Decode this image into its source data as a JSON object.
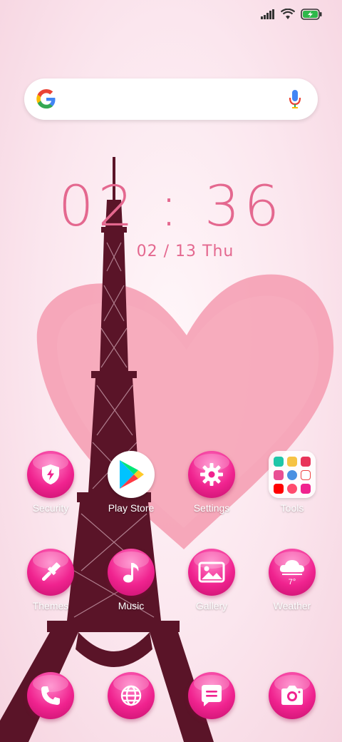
{
  "status_bar": {
    "icons": [
      "signal-icon",
      "wifi-icon",
      "battery-charging-icon"
    ]
  },
  "search": {
    "placeholder": ""
  },
  "clock": {
    "time": "02 : 36",
    "date": "02 / 13  Thu"
  },
  "apps": {
    "security": "Security",
    "play_store": "Play Store",
    "settings": "Settings",
    "tools": "Tools",
    "themes": "Themes",
    "music": "Music",
    "gallery": "Gallery",
    "weather": "Weather",
    "weather_temp": "7°"
  },
  "dock": [
    "phone-icon",
    "browser-icon",
    "messages-icon",
    "camera-icon"
  ],
  "colors": {
    "accent": "#e4688f",
    "icon_pink": "#f0238f",
    "heart": "#f49bb0",
    "tower": "#5a1428"
  }
}
